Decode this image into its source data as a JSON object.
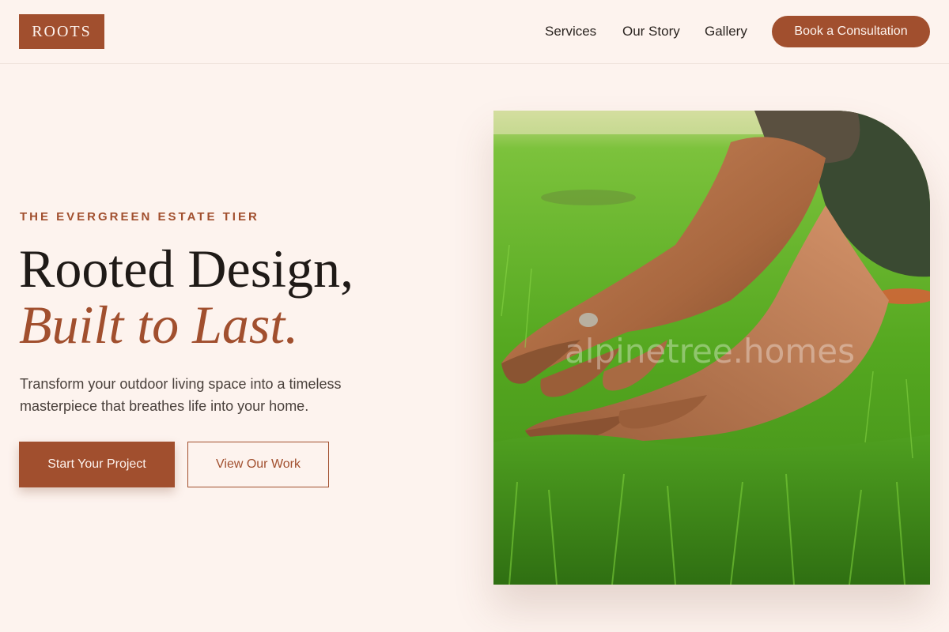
{
  "header": {
    "logo": "ROOTS",
    "nav": [
      "Services",
      "Our Story",
      "Gallery"
    ],
    "cta_label": "Book a Consultation"
  },
  "hero": {
    "eyebrow": "THE EVERGREEN ESTATE TIER",
    "headline_line1": "Rooted Design,",
    "headline_line2": "Built to Last.",
    "subcopy": "Transform your outdoor living space into a timeless masterpiece that breathes life into your home.",
    "primary_button": "Start Your Project",
    "secondary_button": "View Our Work",
    "image": {
      "watermark": "alpinetree.homes",
      "subject": "hands-on-grass-photo"
    }
  },
  "colors": {
    "background": "#fdf3ee",
    "accent": "#a14f2e",
    "text": "#1f1a17"
  }
}
